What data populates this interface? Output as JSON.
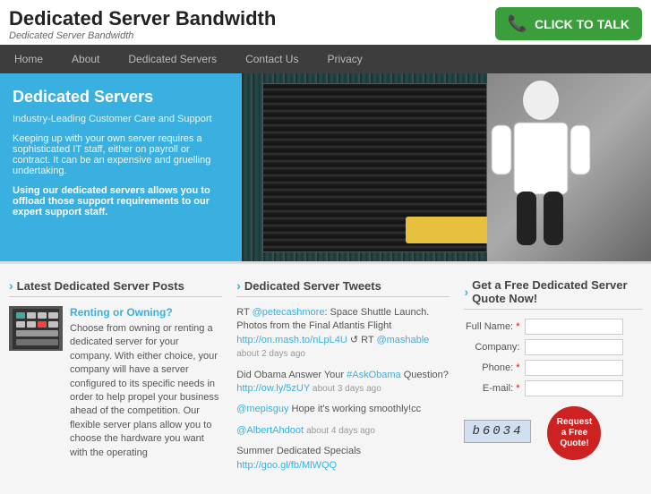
{
  "header": {
    "title": "Dedicated Server Bandwidth",
    "subtitle": "Dedicated Server Bandwidth",
    "cta_label": "CLICK TO TALK"
  },
  "nav": {
    "items": [
      {
        "label": "Home",
        "active": false
      },
      {
        "label": "About",
        "active": false
      },
      {
        "label": "Dedicated Servers",
        "active": false
      },
      {
        "label": "Contact Us",
        "active": false
      },
      {
        "label": "Privacy",
        "active": false
      }
    ]
  },
  "hero": {
    "title": "Dedicated Servers",
    "subtitle": "Industry-Leading Customer Care and Support",
    "body1": "Keeping up with your own server requires a sophisticated IT staff, either on payroll or contract. It can be an expensive and gruelling undertaking.",
    "highlight": "Using our dedicated servers allows you to offload those support requirements to our expert support staff."
  },
  "latest_posts": {
    "section_title": "Latest Dedicated Server Posts",
    "posts": [
      {
        "title": "Renting or Owning?",
        "body": "Choose from owning or renting a dedicated server for your company. With either choice, your company will have a server configured to its specific needs in order to help propel your business ahead of the competition. Our flexible server plans allow you to choose the hardware you want with the operating"
      }
    ]
  },
  "tweets": {
    "section_title": "Dedicated Server Tweets",
    "items": [
      {
        "text": "RT @petecashmore: Space Shuttle Launch. Photos from the Final Atlantis Flight",
        "link_text": "http://on.mash.to/nLpL4U",
        "link_href": "#",
        "extra": "↺ RT @mashable",
        "meta": "about 2 days ago"
      },
      {
        "text": "Did Obama Answer Your #AskObama Question?",
        "link_text": "http://ow.ly/5zUY",
        "link_href": "#",
        "meta": "about 3 days ago"
      },
      {
        "text": "@mepisguy Hope it's working smoothly!cc",
        "link_text": "",
        "meta": ""
      },
      {
        "text": "@AlbertAhdoot",
        "link_text": "",
        "meta": "about 4 days ago"
      },
      {
        "text": "Summer Dedicated Specials",
        "link_text": "http://goo.gl/fb/MlWQQ",
        "link_href": "#",
        "meta": ""
      }
    ]
  },
  "quote_form": {
    "section_title": "Get a Free Dedicated Server Quote Now!",
    "fields": [
      {
        "label": "Full Name:",
        "required": true,
        "name": "full_name"
      },
      {
        "label": "Company:",
        "required": false,
        "name": "company"
      },
      {
        "label": "Phone:",
        "required": true,
        "name": "phone"
      },
      {
        "label": "E-mail:",
        "required": true,
        "name": "email"
      }
    ],
    "captcha_text": "b6034",
    "button_label": "Request a Free Quote!"
  }
}
